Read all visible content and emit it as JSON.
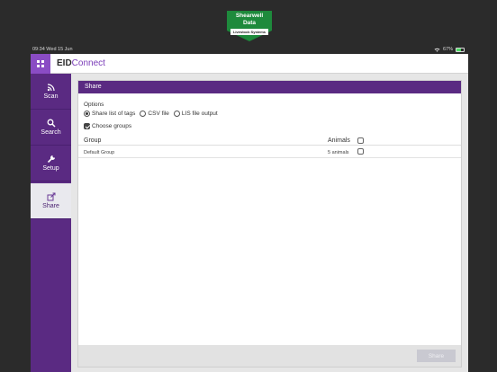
{
  "logo": {
    "line1": "Shearwell",
    "line2": "Data",
    "tagline": "Livestock Systems"
  },
  "status_bar": {
    "time": "09:34",
    "date": "Wed 15 Jun",
    "battery": "67%"
  },
  "app": {
    "brand_part1": "EID",
    "brand_part2": "Connect"
  },
  "sidebar": {
    "items": [
      {
        "label": "Scan",
        "icon": "scan-icon",
        "active": false
      },
      {
        "label": "Search",
        "icon": "search-icon",
        "active": false
      },
      {
        "label": "Setup",
        "icon": "wrench-icon",
        "active": false
      },
      {
        "label": "Share",
        "icon": "share-icon",
        "active": true
      }
    ]
  },
  "share": {
    "title": "Share",
    "options_label": "Options",
    "options": [
      {
        "label": "Share list of tags",
        "selected": true
      },
      {
        "label": "CSV file",
        "selected": false
      },
      {
        "label": "LIS file output",
        "selected": false
      }
    ],
    "choose_groups": {
      "label": "Choose groups",
      "checked": true
    },
    "table": {
      "headers": {
        "group": "Group",
        "animals": "Animals"
      },
      "rows": [
        {
          "group": "Default Group",
          "animals": "5 animals",
          "checked": false
        }
      ]
    },
    "button_label": "Share"
  },
  "colors": {
    "brand": "#5a2a82",
    "accent": "#8a4cc4",
    "logo_green": "#1e8a3c"
  }
}
